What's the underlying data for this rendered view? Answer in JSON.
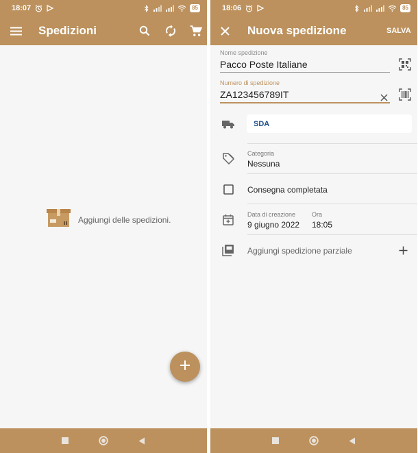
{
  "left_screen": {
    "status": {
      "time": "18:07",
      "battery": "85"
    },
    "app_bar": {
      "title": "Spedizioni"
    },
    "empty_state": {
      "text": "Aggiungi delle spedizioni."
    },
    "fab": {
      "icon": "plus-icon"
    }
  },
  "right_screen": {
    "status": {
      "time": "18:06",
      "battery": "85"
    },
    "app_bar": {
      "title": "Nuova spedizione",
      "save_label": "SALVA"
    },
    "form": {
      "name_label": "Nome spedizione",
      "name_value": "Pacco Poste Italiane",
      "number_label": "Numero di spedizione",
      "number_value": "ZA123456789IT",
      "courier": "SDA",
      "category_label": "Categoria",
      "category_value": "Nessuna",
      "delivered_label": "Consegna completata",
      "delivered_checked": false,
      "date_label": "Data di creazione",
      "date_value": "9 giugno 2022",
      "time_label": "Ora",
      "time_value": "18:05",
      "partial_label": "Aggiungi spedizione parziale"
    }
  },
  "colors": {
    "primary": "#bc915d",
    "background": "#f6f6f6",
    "courier_text": "#1f4f8c",
    "nav_icons": "#e9e3dc"
  }
}
